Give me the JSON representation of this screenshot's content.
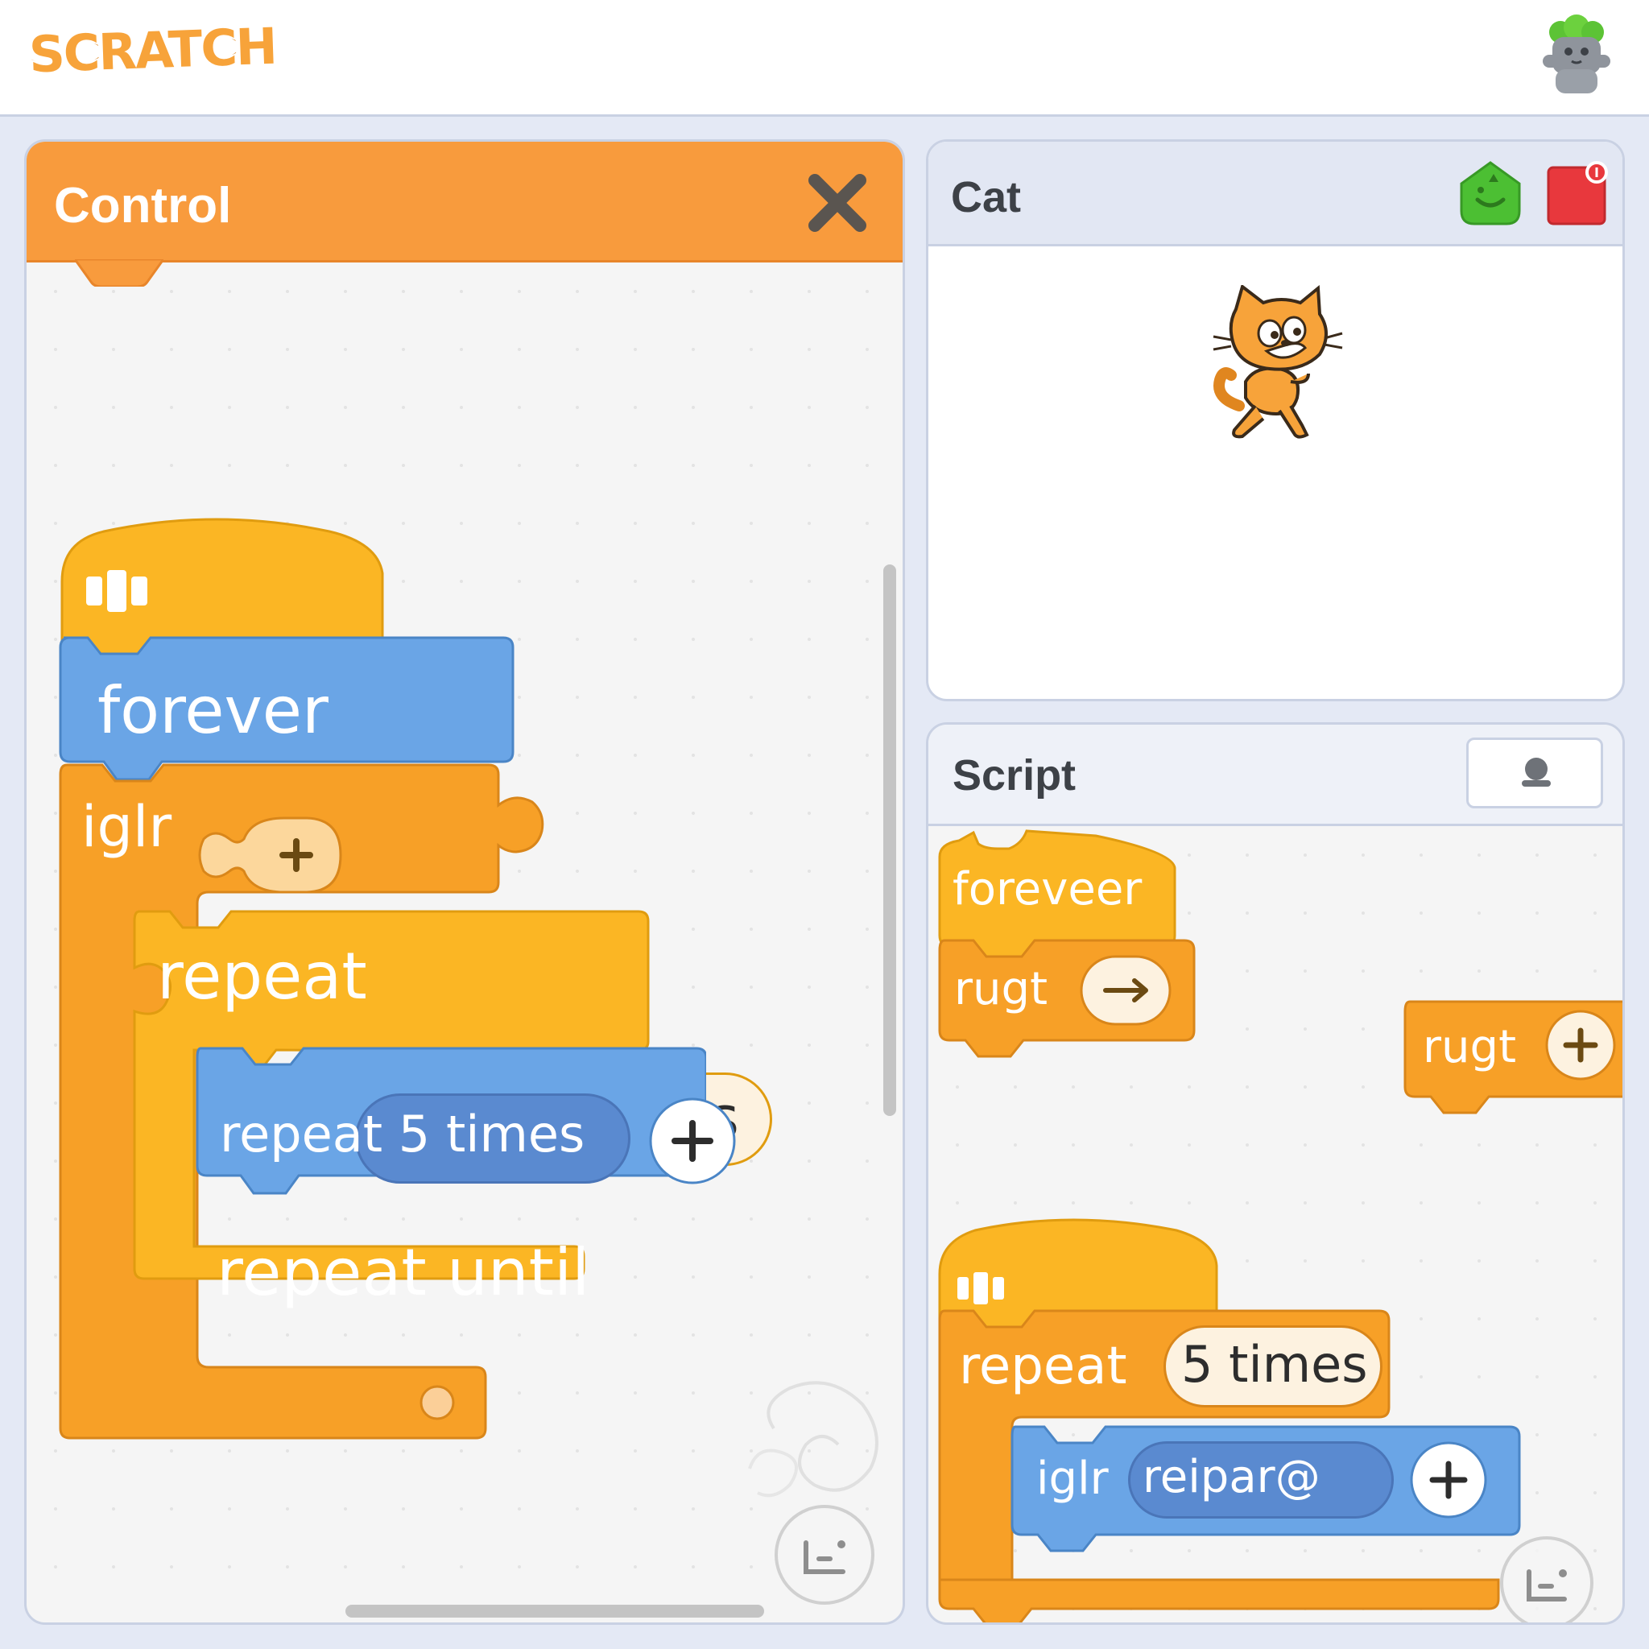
{
  "app": {
    "logo": "SCRATCH"
  },
  "palette": {
    "title": "Control",
    "blocks": {
      "forever": "forever",
      "iglr": "iglr",
      "repeat": "repeat",
      "repeat_count": "5 times",
      "repeat_5_times": "repeat 5 times",
      "repeat_until": "repeat until"
    }
  },
  "stage": {
    "title": "Cat"
  },
  "script": {
    "title": "Script",
    "blocks": {
      "foreveer": "foreveer",
      "rugt_1": "rugt",
      "rugt_2": "rugt",
      "repeat": "repeat",
      "repeat_count": "5 times",
      "iglr": "iglr",
      "reipar": "reipar@"
    }
  },
  "colors": {
    "control_orange": "#f89b3d",
    "block_yellow": "#fbb624",
    "block_orange": "#f7a027",
    "motion_blue": "#6aa5e6",
    "panel_border": "#c9d1e3",
    "green_flag": "#4cbf33",
    "stop_red": "#e8383d"
  },
  "icons": [
    "scratch-logo",
    "profile-icon",
    "close-icon",
    "green-flag-icon",
    "stop-icon",
    "user-icon",
    "zoom-icon",
    "plus-icon",
    "arrow-icon"
  ]
}
